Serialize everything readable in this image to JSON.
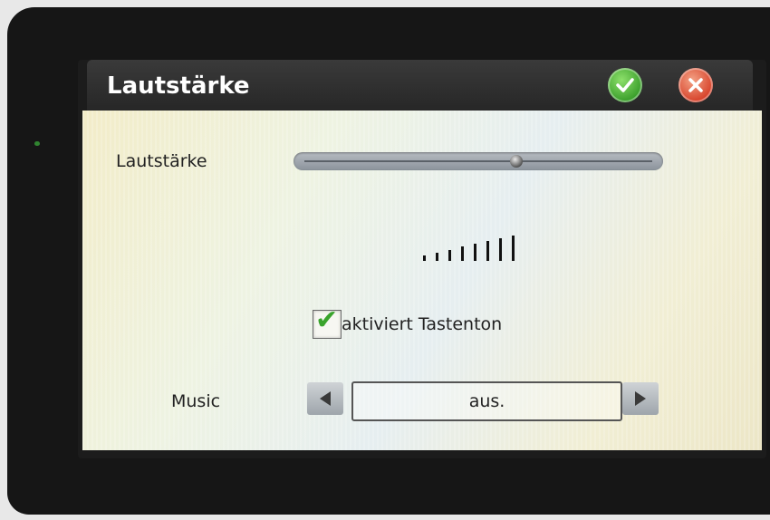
{
  "dialog": {
    "title": "Lautstärke",
    "ok_icon": "check-icon",
    "cancel_icon": "close-icon"
  },
  "volume": {
    "label": "Lautstärke",
    "level_fraction": 0.61,
    "indicator_bars": 8
  },
  "keytone": {
    "label": "aktiviert Tastenton",
    "checked": true
  },
  "music": {
    "label": "Music",
    "value": "aus.",
    "prev_icon": "arrow-left-icon",
    "next_icon": "arrow-right-icon"
  },
  "colors": {
    "ok": "#3a9e2b",
    "cancel": "#d7432b",
    "check": "#3aa42d"
  }
}
